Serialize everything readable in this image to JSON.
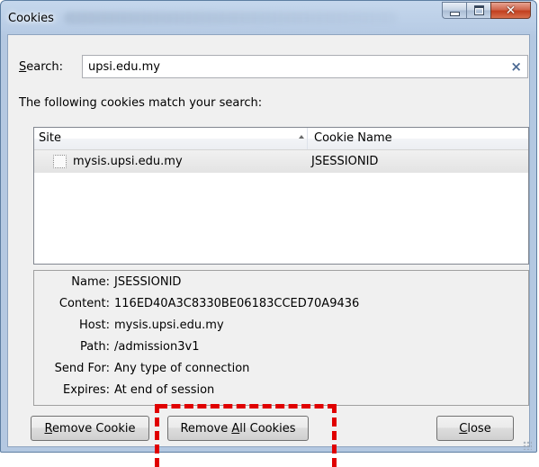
{
  "window": {
    "title": "Cookies",
    "accent": "#b9cde6",
    "close_color": "#c2401f"
  },
  "search": {
    "label_accel": "S",
    "label_rest": "earch:",
    "value": "upsi.edu.my",
    "clear_icon": "×"
  },
  "match_label": "The following cookies match your search:",
  "tree": {
    "columns": {
      "site": "Site",
      "cookie_name": "Cookie Name"
    },
    "rows": [
      {
        "site": "mysis.upsi.edu.my",
        "cookie_name": "JSESSIONID"
      }
    ]
  },
  "details": {
    "name_key": "Name:",
    "name_val": "JSESSIONID",
    "content_key": "Content:",
    "content_val": "116ED40A3C8330BE06183CCED70A9436",
    "host_key": "Host:",
    "host_val": "mysis.upsi.edu.my",
    "path_key": "Path:",
    "path_val": "/admission3v1",
    "sendfor_key": "Send For:",
    "sendfor_val": "Any type of connection",
    "expires_key": "Expires:",
    "expires_val": "At end of session"
  },
  "buttons": {
    "remove_accel": "R",
    "remove_rest": "emove Cookie",
    "remove_all_pre": "Remove ",
    "remove_all_accel": "A",
    "remove_all_rest": "ll Cookies",
    "close_accel": "C",
    "close_rest": "lose"
  },
  "annotation_color": "#e00000"
}
